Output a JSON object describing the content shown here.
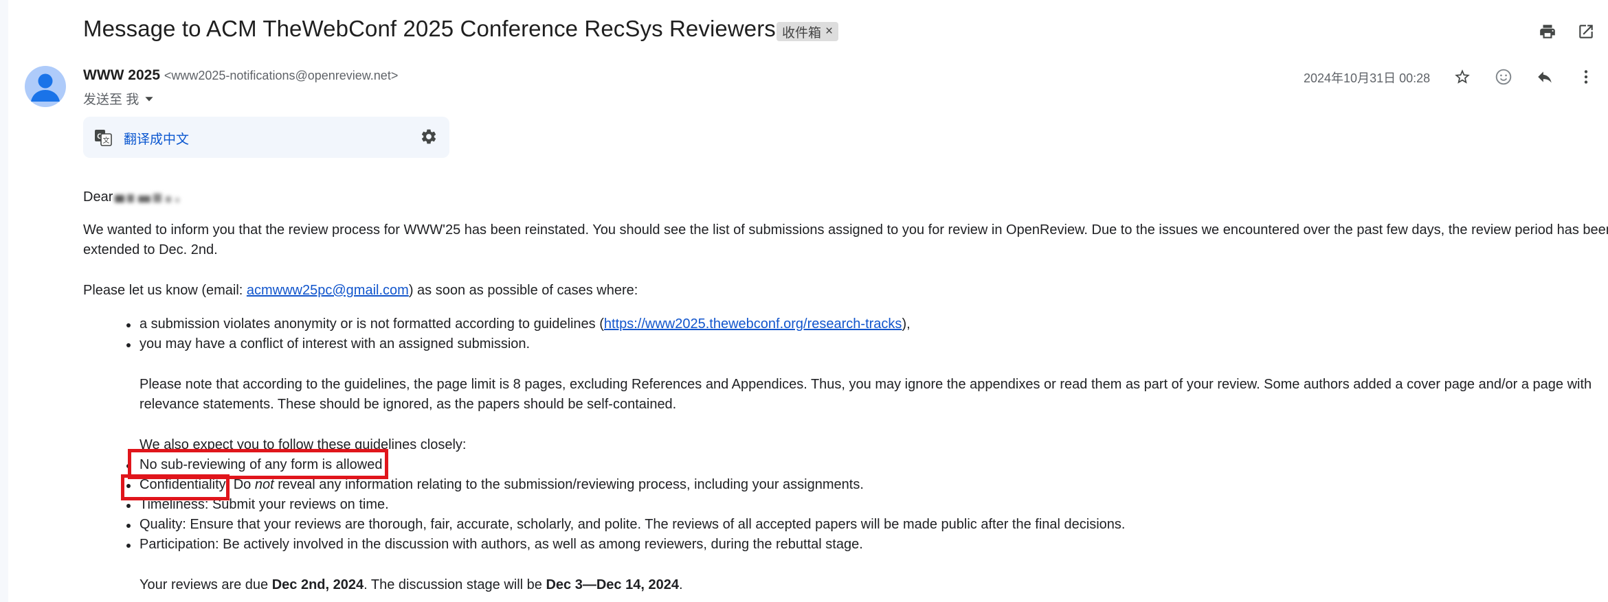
{
  "email": {
    "subject": "Message to ACM TheWebConf 2025 Conference RecSys Reviewers",
    "label": "收件箱",
    "label_remove": "×",
    "sender_name": "WWW 2025",
    "sender_email": "<www2025-notifications@openreview.net>",
    "to_me": "发送至 我",
    "date": "2024年10月31日 00:28",
    "translate_label": "翻译成中文"
  },
  "body": {
    "greeting": "Dear",
    "p1_line1": "We wanted to inform you that the review process for WWW'25 has been reinstated. You should see the list of submissions assigned to you for review in OpenReview. Due to the issues we encountered over the past few days, the review period has been",
    "p1_line2": "extended to Dec. 2nd.",
    "p2_pre": "Please let us know (email: ",
    "p2_email": "acmwww25pc@gmail.com",
    "p2_post": ") as soon as possible of cases where:",
    "b1_pre": "a submission violates anonymity or is not formatted according to guidelines (",
    "b1_link": "https://www2025.thewebconf.org/research-tracks",
    "b1_post": "),",
    "b2": "you may have a conflict of interest with an assigned submission.",
    "p3_line1": "Please note that according to the guidelines, the page limit is 8 pages, excluding References and Appendices. Thus, you may ignore the appendixes or read them as part of your review. Some authors added a cover page and/or a page with",
    "p3_line2": "relevance statements. These should be ignored, as the papers should be self-contained.",
    "p4": "We also expect you to follow these guidelines closely:",
    "g1": "No sub-reviewing of any form is allowed",
    "g2_pre": "Confidentiality: Do ",
    "g2_em": "not",
    "g2_post": " reveal any information relating to the submission/reviewing process, including your assignments.",
    "g3": "Timeliness: Submit your reviews on time.",
    "g4": "Quality: Ensure that your reviews are thorough, fair, accurate, scholarly, and polite.  The reviews of all accepted papers will be made public after the final decisions.",
    "g5": "Participation: Be actively involved in the discussion with authors, as well as among reviewers, during the rebuttal stage.",
    "p5_pre": "Your reviews are due ",
    "p5_due": "Dec 2nd, 2024",
    "p5_mid": ".  The discussion stage will be ",
    "p5_disc": "Dec 3—Dec 14, 2024",
    "p5_post": "."
  },
  "colors": {
    "annotation_box": "#e0151b",
    "link": "#1155cc",
    "translate_link": "#0b57d0"
  }
}
